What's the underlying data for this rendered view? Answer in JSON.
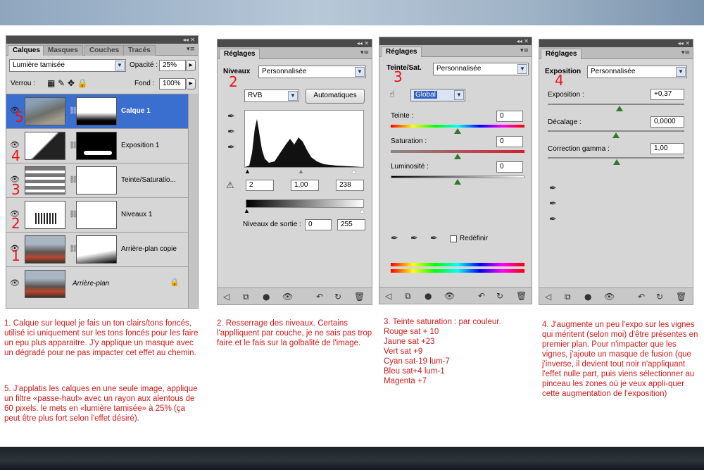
{
  "layers_panel": {
    "tabs": [
      "Calques",
      "Masques",
      "Couches",
      "Tracés"
    ],
    "blend_mode": "Lumière tamisée",
    "opacity_label": "Opacité :",
    "opacity_value": "25%",
    "lock_label": "Verrou :",
    "fill_label": "Fond :",
    "fill_value": "100%",
    "layers": [
      {
        "name": "Calque 1",
        "number": "5"
      },
      {
        "name": "Exposition 1",
        "number": "4"
      },
      {
        "name": "Teinte/Saturatio...",
        "number": "3"
      },
      {
        "name": "Niveaux 1",
        "number": "2"
      },
      {
        "name": "Arrière-plan copie",
        "number": "1"
      },
      {
        "name": "Arrière-plan",
        "number": ""
      }
    ]
  },
  "levels_panel": {
    "title": "Réglages",
    "subtitle": "Niveaux",
    "preset": "Personnalisée",
    "number": "2",
    "channel": "RVB",
    "auto_button": "Automatiques",
    "input_black": "2",
    "input_mid": "1,00",
    "input_white": "238",
    "output_label": "Niveaux de sortie :",
    "output_black": "0",
    "output_white": "255"
  },
  "huesat_panel": {
    "title": "Réglages",
    "subtitle": "Teinte/Sat.",
    "preset": "Personnalisée",
    "number": "3",
    "channel": "Global",
    "hue_label": "Teinte :",
    "hue_value": "0",
    "sat_label": "Saturation :",
    "sat_value": "0",
    "lum_label": "Luminosité :",
    "lum_value": "0",
    "colorize_label": "Redéfinir"
  },
  "exposure_panel": {
    "title": "Réglages",
    "subtitle": "Exposition",
    "preset": "Personnalisée",
    "number": "4",
    "exposure_label": "Exposition :",
    "exposure_value": "+0,37",
    "offset_label": "Décalage :",
    "offset_value": "0,0000",
    "gamma_label": "Correction gamma :",
    "gamma_value": "1,00"
  },
  "captions": {
    "c1": "1. Calque sur lequel je fais un ton clairs/tons foncés, utilisé ici uniquement sur les tons foncés pour les faire un epu plus apparaitre. J'y applique un masque avec un dégradé pour ne pas impacter cet effet au chemin.",
    "c5": "5. J'applatis les calques en une seule image, applique un filtre «passe-haut» avec un rayon aux alentous de 60 pixels. le mets en «lumière tamisée» à 25% (ça peut être plus fort selon l'effet désiré).",
    "c2": "2. Resserrage des niveaux. Certains l'applliquent par couche, je ne sais pas trop faire et le fais sur la golbalité de l'image.",
    "c3_lines": [
      "3. Teinte saturation : par couleur.",
      "Rouge sat + 10",
      "Jaune sat +23",
      "Vert sat +9",
      "Cyan sat-19 lum-7",
      "Bleu sat+4 lum-1",
      "Magenta +7"
    ],
    "c4": "4. J'augmente un peu l'expo sur les vignes qui méritent (selon moi) d'être présentes en premier plan. Pour n'impacter que les vignes, j'ajoute un masque de fusion (que j'inverse, il devient tout noir n'appliquant l'effet nulle part, puis viens sélectionner au pinceau les zones où je veux appli-quer cette augmentation de l'exposition)"
  }
}
